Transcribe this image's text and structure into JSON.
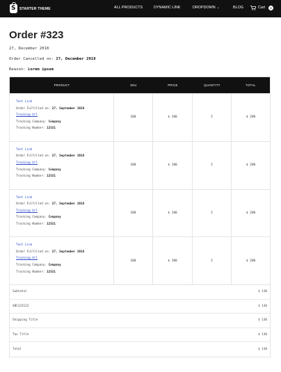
{
  "header": {
    "brand": "STARTER THEME",
    "brand_glyph": "S",
    "nav": [
      {
        "label": "ALL PRODUCTS"
      },
      {
        "label": "DYNAMIC LINK"
      },
      {
        "label": "DROPDOWN"
      },
      {
        "label": "BLOG"
      }
    ],
    "cart_label": "Cart",
    "cart_count": "0",
    "dropdown_icon": "chevron-down-icon",
    "cart_icon": "shopping-cart-icon"
  },
  "order": {
    "title": "Order #323",
    "date": "27, December 2018",
    "cancelled_label": "Order Cancelled on:",
    "cancelled_value": "27, December 2018",
    "reason_label": "Reason:",
    "reason_value": "Lorem ipsum"
  },
  "table": {
    "headers": [
      "PRODUCT",
      "SKU",
      "PRICE",
      "QUANTITY",
      "TOTAL"
    ],
    "rows": [
      {
        "link": "Test Link",
        "fulfilled_label": "Order Fulfilled on:",
        "fulfilled_value": "27, September 2018",
        "tracking_url": "Tracking Url",
        "company_label": "Tracking Company:",
        "company_value": "Company",
        "number_label": "Tracking Number:",
        "number_value": "12321",
        "sku": "100",
        "price": "$ 100",
        "quantity": "2",
        "total": "$ 200"
      },
      {
        "link": "Test Link",
        "fulfilled_label": "Order Fulfilled on:",
        "fulfilled_value": "27, September 2018",
        "tracking_url": "Tracking Url",
        "company_label": "Tracking Company:",
        "company_value": "Company",
        "number_label": "Tracking Number:",
        "number_value": "12321",
        "sku": "100",
        "price": "$ 100",
        "quantity": "2",
        "total": "$ 200"
      },
      {
        "link": "Test Link",
        "fulfilled_label": "Order Fulfilled on:",
        "fulfilled_value": "27, September 2018",
        "tracking_url": "Tracking Url",
        "company_label": "Tracking Company:",
        "company_value": "Company",
        "number_label": "Tracking Number:",
        "number_value": "12321",
        "sku": "100",
        "price": "$ 100",
        "quantity": "2",
        "total": "$ 200"
      },
      {
        "link": "Test Link",
        "fulfilled_label": "Order Fulfilled on:",
        "fulfilled_value": "27, September 2018",
        "tracking_url": "Tracking Url",
        "company_label": "Tracking Company:",
        "company_value": "Company",
        "number_label": "Tracking Number:",
        "number_value": "12321",
        "sku": "100",
        "price": "$ 100",
        "quantity": "2",
        "total": "$ 200"
      }
    ],
    "summary": [
      {
        "label": "Subtotal",
        "value": "$ 130"
      },
      {
        "label": "ABC123123",
        "value": "$ 130"
      },
      {
        "label": "Shipping Title",
        "value": "$ 130"
      },
      {
        "label": "Tax Title",
        "value": "$ 130"
      },
      {
        "label": "Total",
        "value": "$ 130"
      }
    ]
  }
}
